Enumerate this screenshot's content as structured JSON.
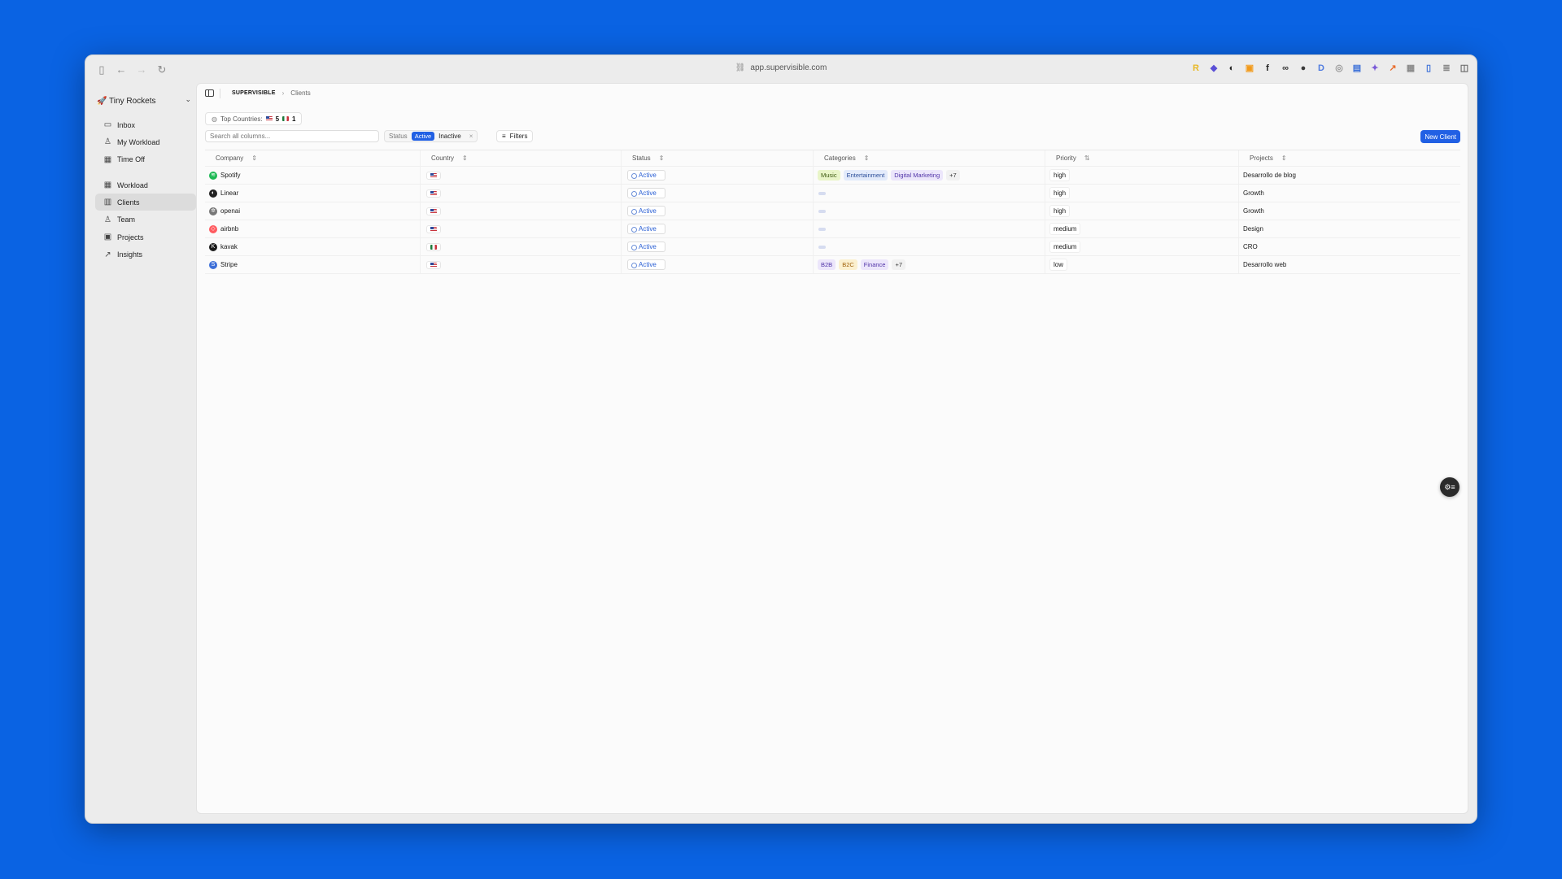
{
  "browser": {
    "url": "app.supervisible.com",
    "extensions": [
      {
        "name": "r-ext-icon",
        "glyph": "R",
        "color": "#e8b824"
      },
      {
        "name": "cube-ext-icon",
        "glyph": "◆",
        "color": "#5a4fd6"
      },
      {
        "name": "pie-ext-icon",
        "glyph": "◐",
        "color": "#222222"
      },
      {
        "name": "bag-ext-icon",
        "glyph": "▣",
        "color": "#f29a1a"
      },
      {
        "name": "f-ext-icon",
        "glyph": "f",
        "color": "#222222"
      },
      {
        "name": "glasses-ext-icon",
        "glyph": "∞",
        "color": "#333333"
      },
      {
        "name": "dark-circle-ext-icon",
        "glyph": "●",
        "color": "#3a3a3a"
      },
      {
        "name": "d-ext-icon",
        "glyph": "D",
        "color": "#4f7be0"
      },
      {
        "name": "camera-ext-icon",
        "glyph": "◎",
        "color": "#9a9a9a"
      },
      {
        "name": "printer-ext-icon",
        "glyph": "▤",
        "color": "#3a6fd8"
      },
      {
        "name": "feather-ext-icon",
        "glyph": "✦",
        "color": "#7a5ad8"
      },
      {
        "name": "arrow-ext-icon",
        "glyph": "↗",
        "color": "#e86b2a"
      },
      {
        "name": "grid-ext-icon",
        "glyph": "▦",
        "color": "#8a8a8a"
      },
      {
        "name": "phone-ext-icon",
        "glyph": "▯",
        "color": "#3a6fd8"
      },
      {
        "name": "reader-ext-icon",
        "glyph": "≣",
        "color": "#8a8a8a"
      },
      {
        "name": "split-view-icon",
        "glyph": "◫",
        "color": "#666666"
      }
    ]
  },
  "sidebar": {
    "workspace": "🚀 Tiny Rockets",
    "items_top": [
      {
        "label": "Inbox",
        "icon": "inbox-icon",
        "glyph": "▭"
      },
      {
        "label": "My Workload",
        "icon": "user-icon",
        "glyph": "♙"
      },
      {
        "label": "Time Off",
        "icon": "calendar-icon",
        "glyph": "▦"
      }
    ],
    "items_main": [
      {
        "label": "Workload",
        "icon": "table-icon",
        "glyph": "▦"
      },
      {
        "label": "Clients",
        "icon": "building-icon",
        "glyph": "▥"
      },
      {
        "label": "Team",
        "icon": "team-icon",
        "glyph": "♙"
      },
      {
        "label": "Projects",
        "icon": "briefcase-icon",
        "glyph": "▣"
      },
      {
        "label": "Insights",
        "icon": "chart-icon",
        "glyph": "↗"
      }
    ],
    "active": "Clients"
  },
  "breadcrumb": {
    "brand": "SUPERVISIBLE",
    "current": "Clients"
  },
  "top_countries": {
    "label": "Top Countries:",
    "us_count": "5",
    "mx_count": "1"
  },
  "toolbar": {
    "search_placeholder": "Search all columns...",
    "status_label": "Status",
    "status_active": "Active",
    "status_inactive": "Inactive",
    "clear": "×",
    "filters": "Filters",
    "new_client": "New Client"
  },
  "table": {
    "headers": [
      "Company",
      "Country",
      "Status",
      "Categories",
      "Priority",
      "Projects"
    ],
    "rows": [
      {
        "company": "Spotify",
        "logo_color": "#1db954",
        "logo_glyph": "≋",
        "country": "us",
        "status": "Active",
        "categories": [
          {
            "label": "Music",
            "bg": "#e9f5c8",
            "fg": "#3d5a10"
          },
          {
            "label": "Entertainment",
            "bg": "#e3ebfb",
            "fg": "#2c4f9a"
          },
          {
            "label": "Digital Marketing",
            "bg": "#ece6fb",
            "fg": "#5134a8"
          }
        ],
        "more": "+7",
        "priority": "high",
        "project": "Desarrollo de blog"
      },
      {
        "company": "Linear",
        "logo_color": "#222222",
        "logo_glyph": "◐",
        "country": "us",
        "status": "Active",
        "categories": [],
        "more": "",
        "priority": "high",
        "project": "Growth"
      },
      {
        "company": "openai",
        "logo_color": "#777777",
        "logo_glyph": "✲",
        "country": "us",
        "status": "Active",
        "categories": [],
        "more": "",
        "priority": "high",
        "project": "Growth"
      },
      {
        "company": "airbnb",
        "logo_color": "#ff5a5f",
        "logo_glyph": "◇",
        "country": "us",
        "status": "Active",
        "categories": [],
        "more": "",
        "priority": "medium",
        "project": "Design"
      },
      {
        "company": "kavak",
        "logo_color": "#1a1a1a",
        "logo_glyph": "K",
        "country": "mx",
        "status": "Active",
        "categories": [],
        "more": "",
        "priority": "medium",
        "project": "CRO"
      },
      {
        "company": "Stripe",
        "logo_color": "#3d6fd8",
        "logo_glyph": "S",
        "country": "us",
        "status": "Active",
        "categories": [
          {
            "label": "B2B",
            "bg": "#ece6fb",
            "fg": "#5134a8"
          },
          {
            "label": "B2C",
            "bg": "#fbf0cf",
            "fg": "#a0620d"
          },
          {
            "label": "Finance",
            "bg": "#ece6fb",
            "fg": "#5134a8"
          }
        ],
        "more": "+7",
        "priority": "low",
        "project": "Desarrollo web"
      }
    ]
  },
  "float_button": {
    "icon": "assistant-icon",
    "glyph": "⚙≡"
  }
}
